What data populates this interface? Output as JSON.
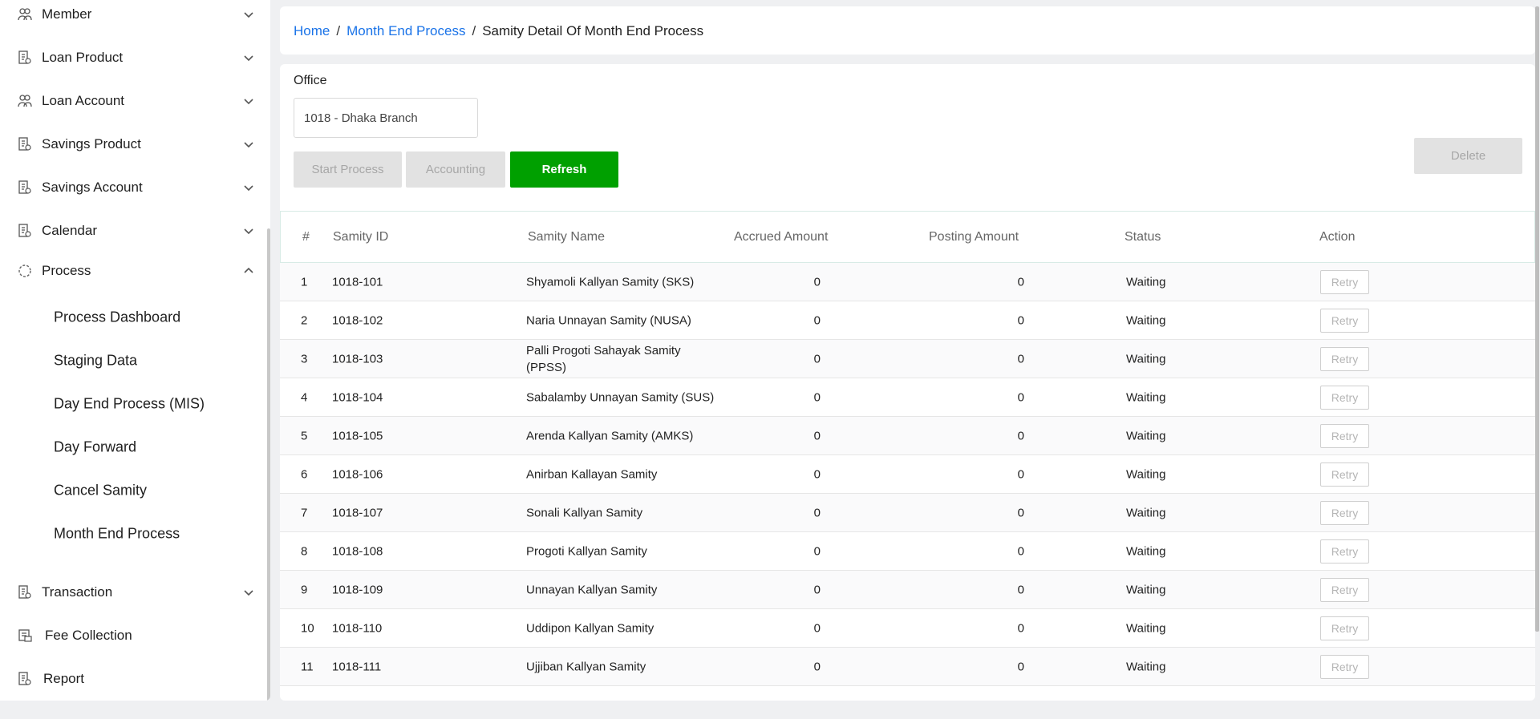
{
  "sidebar": {
    "items": [
      {
        "label": "Member",
        "icon": "people-icon",
        "expanded": false
      },
      {
        "label": "Loan Product",
        "icon": "document-icon",
        "expanded": false
      },
      {
        "label": "Loan Account",
        "icon": "people-icon",
        "expanded": false
      },
      {
        "label": "Savings Product",
        "icon": "document-icon",
        "expanded": false
      },
      {
        "label": "Savings Account",
        "icon": "document-icon",
        "expanded": false
      },
      {
        "label": "Calendar",
        "icon": "document-icon",
        "expanded": false
      },
      {
        "label": "Process",
        "icon": "process-icon",
        "expanded": true
      }
    ],
    "process_sub": [
      {
        "label": "Process Dashboard"
      },
      {
        "label": "Staging Data"
      },
      {
        "label": "Day End Process (MIS)"
      },
      {
        "label": "Day Forward"
      },
      {
        "label": "Cancel Samity"
      },
      {
        "label": "Month End Process"
      }
    ],
    "bottom_items": [
      {
        "label": "Transaction",
        "icon": "document-icon"
      },
      {
        "label": "Fee Collection",
        "icon": "fee-icon"
      },
      {
        "label": "Report",
        "icon": "document-icon"
      }
    ]
  },
  "breadcrumb": {
    "home": "Home",
    "section": "Month End Process",
    "current": "Samity Detail Of Month End Process",
    "separator": "/"
  },
  "office": {
    "label": "Office",
    "value": "1018 - Dhaka Branch"
  },
  "buttons": {
    "start_process": "Start Process",
    "accounting": "Accounting",
    "refresh": "Refresh",
    "delete": "Delete"
  },
  "table": {
    "headers": [
      "#",
      "Samity ID",
      "Samity Name",
      "Accrued Amount",
      "Posting Amount",
      "Status",
      "Action"
    ],
    "retry_label": "Retry",
    "rows": [
      {
        "n": "1",
        "id": "1018-101",
        "name": "Shyamoli Kallyan Samity (SKS)",
        "accrued": "0",
        "posting": "0",
        "status": "Waiting"
      },
      {
        "n": "2",
        "id": "1018-102",
        "name": "Naria Unnayan Samity (NUSA)",
        "accrued": "0",
        "posting": "0",
        "status": "Waiting"
      },
      {
        "n": "3",
        "id": "1018-103",
        "name": "Palli Progoti Sahayak Samity (PPSS)",
        "accrued": "0",
        "posting": "0",
        "status": "Waiting"
      },
      {
        "n": "4",
        "id": "1018-104",
        "name": "Sabalamby Unnayan Samity (SUS)",
        "accrued": "0",
        "posting": "0",
        "status": "Waiting"
      },
      {
        "n": "5",
        "id": "1018-105",
        "name": "Arenda Kallyan Samity (AMKS)",
        "accrued": "0",
        "posting": "0",
        "status": "Waiting"
      },
      {
        "n": "6",
        "id": "1018-106",
        "name": "Anirban Kallayan Samity",
        "accrued": "0",
        "posting": "0",
        "status": "Waiting"
      },
      {
        "n": "7",
        "id": "1018-107",
        "name": "Sonali Kallyan Samity",
        "accrued": "0",
        "posting": "0",
        "status": "Waiting"
      },
      {
        "n": "8",
        "id": "1018-108",
        "name": "Progoti Kallyan Samity",
        "accrued": "0",
        "posting": "0",
        "status": "Waiting"
      },
      {
        "n": "9",
        "id": "1018-109",
        "name": "Unnayan Kallyan Samity",
        "accrued": "0",
        "posting": "0",
        "status": "Waiting"
      },
      {
        "n": "10",
        "id": "1018-110",
        "name": "Uddipon Kallyan Samity",
        "accrued": "0",
        "posting": "0",
        "status": "Waiting"
      },
      {
        "n": "11",
        "id": "1018-111",
        "name": "Ujjiban Kallyan Samity",
        "accrued": "0",
        "posting": "0",
        "status": "Waiting"
      }
    ]
  }
}
